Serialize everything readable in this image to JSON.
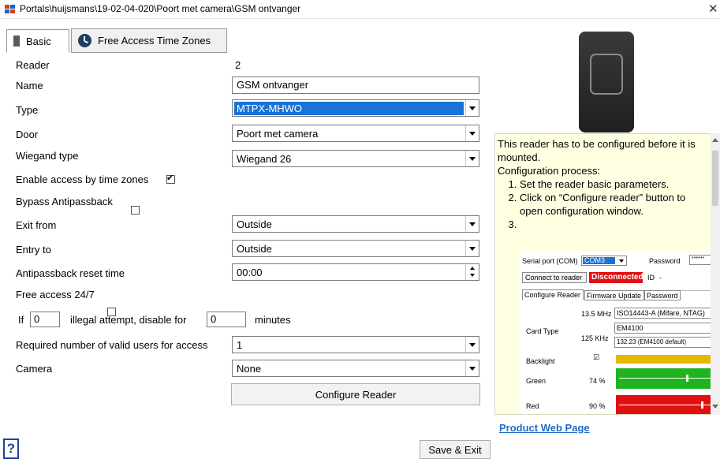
{
  "window": {
    "title": "Portals\\huijsmans\\19-02-04-020\\Poort met camera\\GSM ontvanger",
    "close_glyph": "✕"
  },
  "tabs": [
    {
      "label": "Basic",
      "icon": "basic-tab-icon"
    },
    {
      "label": "Free Access Time Zones",
      "icon": "clock-icon"
    }
  ],
  "form": {
    "reader_label": "Reader",
    "reader_value": "2",
    "name_label": "Name",
    "name_value": "GSM ontvanger",
    "type_label": "Type",
    "type_value": "MTPX-MHWO",
    "door_label": "Door",
    "door_value": "Poort met camera",
    "wiegand_label": "Wiegand type",
    "wiegand_value": "Wiegand 26",
    "enable_access_label": "Enable access by time zones",
    "enable_access_checked": true,
    "bypass_label": "Bypass Antipassback",
    "bypass_checked": false,
    "exit_from_label": "Exit from",
    "exit_from_value": "Outside",
    "entry_to_label": "Entry to",
    "entry_to_value": "Outside",
    "apb_reset_label": "Antipassback reset time",
    "apb_reset_value": "00:00",
    "free_access_label": "Free access 24/7",
    "free_access_checked": false,
    "if_label": "If",
    "if_value": "0",
    "illegal_label": "illegal attempt, disable for",
    "disable_value": "0",
    "minutes_label": "minutes",
    "required_users_label": "Required number of valid users for access",
    "required_users_value": "1",
    "camera_label": "Camera",
    "camera_value": "None",
    "configure_button": "Configure Reader"
  },
  "info": {
    "line1": "This reader has to be configured before it is mounted.",
    "line2": "Configuration process:",
    "steps": [
      "Set the reader basic parameters.",
      "Click on “Configure reader” button to open configuration window.",
      ""
    ],
    "mini": {
      "serial_label": "Serial port (COM)",
      "serial_value": "COM3",
      "password_label": "Password",
      "password_value": "******",
      "connect_button": "Connect to reader",
      "status": "Disconnected",
      "id_label": "ID",
      "id_value": "-",
      "tabs": [
        "Configure Reader",
        "Firmware Update",
        "Password"
      ],
      "card_type_label": "Card Type",
      "freq1": "13.5 MHz",
      "freq1_value": "ISO14443-A (Mifare, NTAG)",
      "freq2": "125 KHz",
      "freq2_value": "EM4100",
      "freq2_value2": "132.23 (EM4100 default)",
      "backlight_label": "Backlight",
      "green_label": "Green",
      "green_value": "74 %",
      "green_level": 0.74,
      "red_label": "Red",
      "red_value": "90 %",
      "red_level": 0.9,
      "colors": {
        "backlight": "#e6b800",
        "green": "#1fb31f",
        "red": "#e01010",
        "status": "#e01010",
        "selected": "#1a73d6"
      }
    }
  },
  "product_link": "Product Web Page",
  "help_button": "?",
  "save_exit_button": "Save & Exit"
}
